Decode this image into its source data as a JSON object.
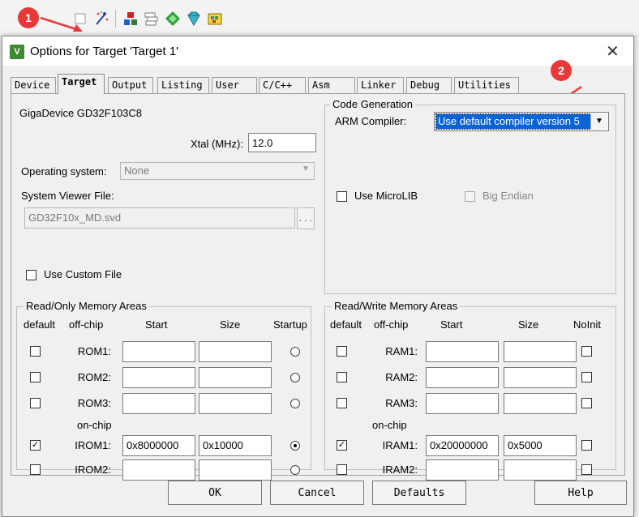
{
  "annotations": {
    "badge1": "1",
    "badge2": "2"
  },
  "dialog": {
    "title": "Options for Target 'Target 1'",
    "close_glyph": "✕"
  },
  "tabs": [
    "Device",
    "Target",
    "Output",
    "Listing",
    "User",
    "C/C++",
    "Asm",
    "Linker",
    "Debug",
    "Utilities"
  ],
  "target": {
    "device_name": "GigaDevice GD32F103C8",
    "xtal_label": "Xtal (MHz):",
    "xtal_value": "12.0",
    "os_label": "Operating system:",
    "os_value": "None",
    "sysviewer_label": "System Viewer File:",
    "sysviewer_value": "GD32F10x_MD.svd",
    "browse_label": "...",
    "custom_file_label": "Use Custom File"
  },
  "codegen": {
    "title": "Code Generation",
    "compiler_label": "ARM Compiler:",
    "compiler_value": "Use default compiler version 5",
    "microlib_label": "Use MicroLIB",
    "bigendian_label": "Big Endian"
  },
  "rom": {
    "title": "Read/Only Memory Areas",
    "headers": {
      "default": "default",
      "offchip": "off-chip",
      "start": "Start",
      "size": "Size",
      "startup": "Startup"
    },
    "onchip_label": "on-chip",
    "rows": [
      {
        "label": "ROM1:",
        "start": "",
        "size": "",
        "default": false,
        "startup": false
      },
      {
        "label": "ROM2:",
        "start": "",
        "size": "",
        "default": false,
        "startup": false
      },
      {
        "label": "ROM3:",
        "start": "",
        "size": "",
        "default": false,
        "startup": false
      },
      {
        "label": "IROM1:",
        "start": "0x8000000",
        "size": "0x10000",
        "default": true,
        "startup": true
      },
      {
        "label": "IROM2:",
        "start": "",
        "size": "",
        "default": false,
        "startup": false
      }
    ]
  },
  "ram": {
    "title": "Read/Write Memory Areas",
    "headers": {
      "default": "default",
      "offchip": "off-chip",
      "start": "Start",
      "size": "Size",
      "noinit": "NoInit"
    },
    "onchip_label": "on-chip",
    "rows": [
      {
        "label": "RAM1:",
        "start": "",
        "size": "",
        "default": false,
        "noinit": false
      },
      {
        "label": "RAM2:",
        "start": "",
        "size": "",
        "default": false,
        "noinit": false
      },
      {
        "label": "RAM3:",
        "start": "",
        "size": "",
        "default": false,
        "noinit": false
      },
      {
        "label": "IRAM1:",
        "start": "0x20000000",
        "size": "0x5000",
        "default": true,
        "noinit": false
      },
      {
        "label": "IRAM2:",
        "start": "",
        "size": "",
        "default": false,
        "noinit": false
      }
    ]
  },
  "buttons": {
    "ok": "OK",
    "cancel": "Cancel",
    "defaults": "Defaults",
    "help": "Help"
  },
  "colors": {
    "badge": "#e8393a",
    "selection": "#0a64d6"
  }
}
